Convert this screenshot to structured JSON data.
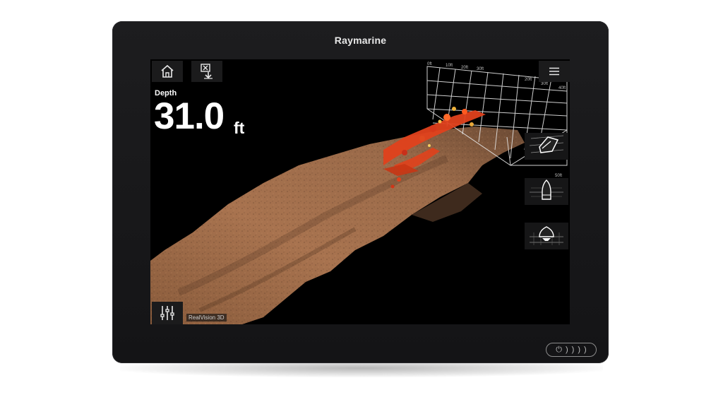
{
  "device": {
    "brand": "Raymarine"
  },
  "screen": {
    "depth_label": "Depth",
    "depth_value": "31.0",
    "depth_unit": "ft",
    "app_label": "RealVision 3D",
    "grid_ticks": [
      "0ft",
      "10ft",
      "20ft",
      "30ft",
      "40ft",
      "10ft",
      "20ft",
      "30ft",
      "40ft",
      "50ft"
    ]
  },
  "icons": {
    "home": "home-icon",
    "waypoint": "waypoint-icon",
    "menu": "menu-icon",
    "settings": "sliders-icon",
    "view_3d": "boat-3d-view-icon",
    "view_top": "boat-top-view-icon",
    "view_front": "boat-front-view-icon",
    "power": "power-icon"
  },
  "colors": {
    "seabed": "#a8734f",
    "fish_targets": "#e0411c",
    "bezel": "#1a1a1c"
  },
  "hardware": {
    "power_symbol": "⏻",
    "button_marks": [
      ")",
      ")",
      ")",
      ")"
    ]
  }
}
